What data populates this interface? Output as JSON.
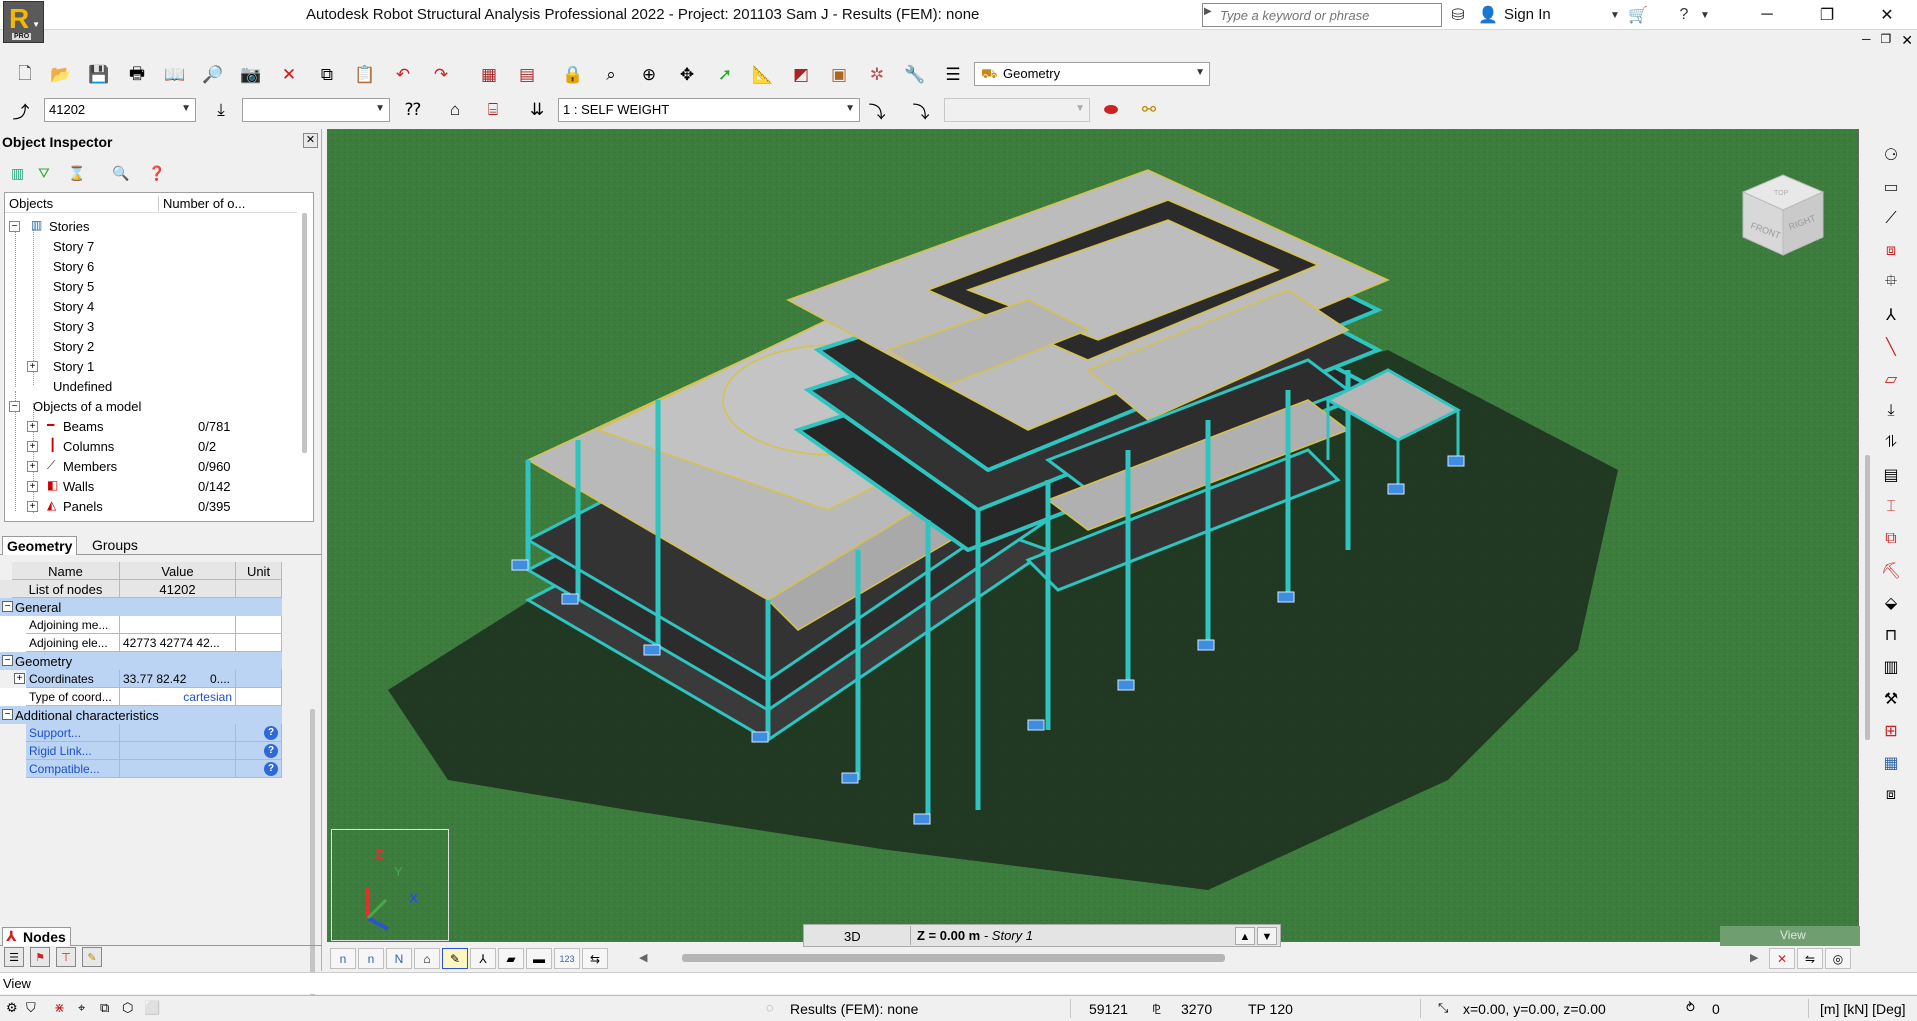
{
  "window": {
    "title": "Autodesk Robot Structural Analysis Professional 2022 - Project: 201103 Sam J - Results (FEM): none",
    "logo_letter": "R",
    "logo_badge": "PRO",
    "search_placeholder": "Type a keyword or phrase",
    "sign_in": "Sign In",
    "controls": [
      "minimize-icon",
      "restore-icon",
      "close-icon"
    ]
  },
  "toolbar1": {
    "layout_select": "Geometry"
  },
  "toolbar2": {
    "node_select": "41202",
    "blank_select": "",
    "load_case_select": "1 : SELF WEIGHT",
    "disabled_select": ""
  },
  "inspector": {
    "title": "Object Inspector",
    "columns": [
      "Objects",
      "Number of o..."
    ],
    "stories_label": "Stories",
    "stories": [
      "Story 7",
      "Story 6",
      "Story 5",
      "Story 4",
      "Story 3",
      "Story 2",
      "Story 1",
      "Undefined"
    ],
    "model_label": "Objects of a model",
    "model_objects": [
      {
        "name": "Beams",
        "count": "0/781"
      },
      {
        "name": "Columns",
        "count": "0/2"
      },
      {
        "name": "Members",
        "count": "0/960"
      },
      {
        "name": "Walls",
        "count": "0/142"
      },
      {
        "name": "Panels",
        "count": "0/395"
      }
    ],
    "tabs": [
      "Geometry",
      "Groups"
    ],
    "prop_headers": [
      "Name",
      "Value",
      "Unit"
    ],
    "list_name": "List of nodes",
    "list_value": "41202",
    "general_label": "General",
    "adj_members": "Adjoining me...",
    "adj_members_value": "",
    "adj_elements": "Adjoining ele...",
    "adj_elements_value": "42773 42774 42...",
    "geometry_label": "Geometry",
    "coords_label": "Coordinates",
    "coords_value": "33.77 82.42",
    "coords_value2": "0....",
    "type_label": "Type of coord...",
    "type_value": "cartesian",
    "additional_label": "Additional characteristics",
    "support": "Support...",
    "rigid_link": "Rigid Link...",
    "compatible": "Compatible...",
    "bottom_tab": "Nodes"
  },
  "viewport": {
    "cube_front": "FRONT",
    "cube_right": "RIGHT",
    "cube_top": "TOP",
    "axis_z": "Z",
    "axis_y": "Y",
    "axis_x": "X",
    "view_mode": "3D",
    "z_level": "Z = 0.00 m",
    "z_story": " - Story 1",
    "watermark": "View",
    "colors": {
      "ground": "#3c7d3e",
      "slab": "#b9b9b9",
      "beam": "#2ec4c0",
      "edge": "#d6c24a"
    }
  },
  "view_label": "View",
  "status": {
    "results": "Results (FEM): none",
    "nodes": "59121",
    "bars": "3270",
    "tp": "TP 120",
    "coords": "x=0.00, y=0.00, z=0.00",
    "zero": "0",
    "units": "[m] [kN] [Deg]"
  }
}
